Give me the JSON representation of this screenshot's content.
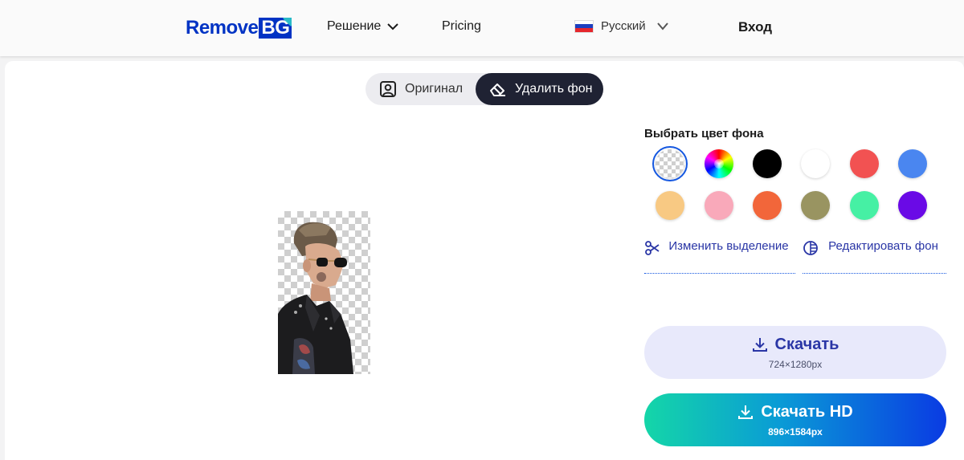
{
  "header": {
    "logo_word": "Remove",
    "logo_badge": "BG",
    "nav": {
      "solution_label": "Решение",
      "pricing_label": "Pricing",
      "language_label": "Русский",
      "login_label": "Вход"
    }
  },
  "toggle": {
    "original_label": "Оригинал",
    "remove_bg_label": "Удалить фон",
    "active": "remove_bg"
  },
  "picker": {
    "title": "Выбрать цвет фона",
    "selected": "transparent",
    "swatches": [
      {
        "name": "transparent",
        "color": "transparent"
      },
      {
        "name": "rainbow",
        "color": "multicolor"
      },
      {
        "name": "black",
        "color": "#000000"
      },
      {
        "name": "white",
        "color": "#ffffff"
      },
      {
        "name": "red",
        "color": "#f25252"
      },
      {
        "name": "blue",
        "color": "#4a86f0"
      },
      {
        "name": "peach",
        "color": "#f8c983"
      },
      {
        "name": "pink",
        "color": "#f9a9ba"
      },
      {
        "name": "orange",
        "color": "#f2663a"
      },
      {
        "name": "olive",
        "color": "#999461"
      },
      {
        "name": "mint",
        "color": "#46f0a4"
      },
      {
        "name": "violet",
        "color": "#6a0ae6"
      }
    ]
  },
  "tools": {
    "change_selection_label": "Изменить выделение",
    "edit_background_label": "Редактировать фон"
  },
  "download": {
    "label": "Скачать",
    "size": "724×1280px"
  },
  "download_hd": {
    "label": "Скачать HD",
    "size": "896×1584px"
  },
  "colors": {
    "brand": "#0033c4",
    "accent_dark": "#1f2233",
    "link": "#2a36a6"
  }
}
